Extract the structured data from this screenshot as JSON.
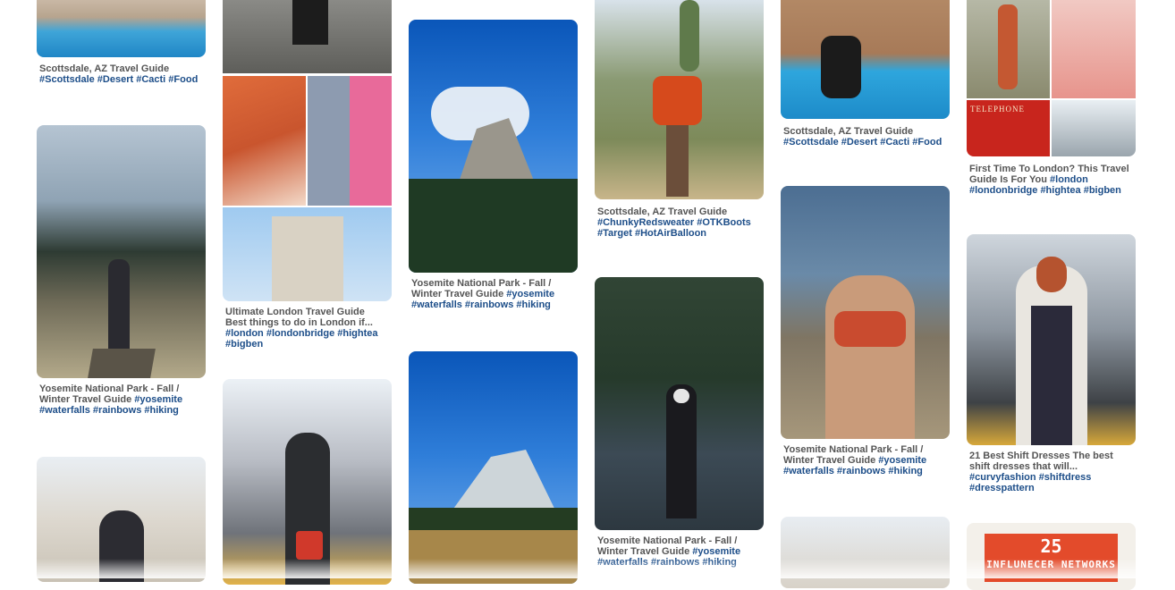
{
  "pins": {
    "p1": {
      "title": "Scottsdale, AZ Travel Guide ",
      "tags": "#Scottsdale #Desert #Cacti #Food"
    },
    "p2": {
      "title": "Yosemite National Park - Fall / Winter Travel Guide ",
      "tags": "#yosemite #waterfalls #rainbows #hiking"
    },
    "p3": {
      "title": "Ultimate London Travel Guide Best things to do in London if... ",
      "tags": "#london #londonbridge #hightea #bigben"
    },
    "p4": {
      "title": "Yosemite National Park - Fall / Winter Travel Guide ",
      "tags": "#yosemite #waterfalls #rainbows #hiking"
    },
    "p5": {
      "title": "Scottsdale, AZ Travel Guide ",
      "tags": "#ChunkyRedsweater #OTKBoots #Target #HotAirBalloon"
    },
    "p6": {
      "title": "Yosemite National Park - Fall / Winter Travel Guide ",
      "tags": "#yosemite #waterfalls #rainbows #hiking"
    },
    "p7": {
      "title": "Scottsdale, AZ Travel Guide ",
      "tags": "#Scottsdale #Desert #Cacti #Food"
    },
    "p8": {
      "title": "Yosemite National Park - Fall / Winter Travel Guide ",
      "tags": "#yosemite #waterfalls #rainbows #hiking"
    },
    "p9": {
      "title": "First Time To London? This Travel Guide Is For You ",
      "tags": "#london #londonbridge #hightea #bigben"
    },
    "p10": {
      "title": "21 Best Shift Dresses The best shift dresses that will... ",
      "tags": "#curvyfashion #shiftdress #dresspattern"
    }
  },
  "images": {
    "london_sign": "TELEPHONE",
    "influencer_num": "25",
    "influencer_text": "INFLUNECER NETWORKS"
  },
  "colors": {
    "tag_link": "#1d4e89",
    "caption_text": "#555555"
  },
  "icons": {
    "pin_image": "photo"
  }
}
